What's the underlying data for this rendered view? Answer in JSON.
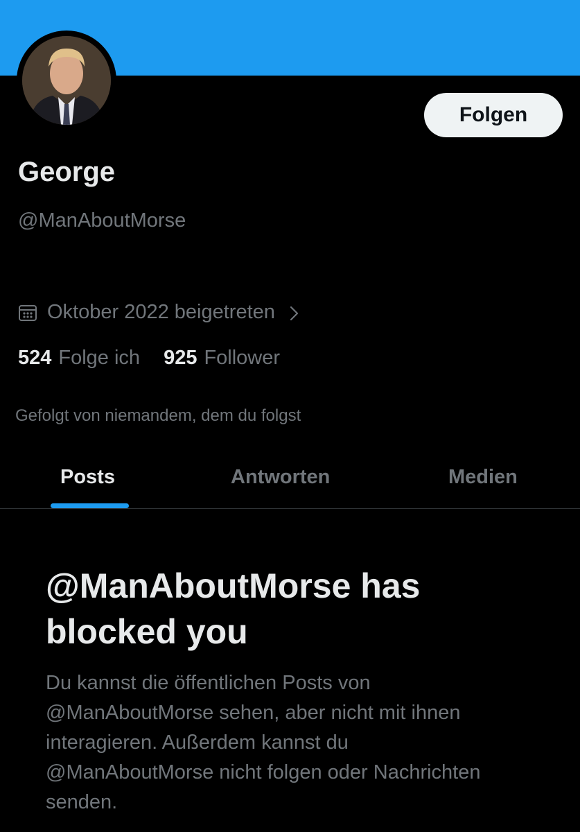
{
  "colors": {
    "accent": "#1d9bf0",
    "background": "#000000",
    "primary_text": "#e7e9ea",
    "secondary_text": "#71767b",
    "button_bg": "#eff3f4",
    "divider": "#2f3336"
  },
  "profile": {
    "display_name": "George",
    "handle": "@ManAboutMorse",
    "follow_label": "Folgen",
    "joined": "Oktober 2022 beigetreten",
    "joined_icon": "calendar-icon",
    "joined_chevron_icon": "chevron-right-icon",
    "avatar": "profile-photo"
  },
  "stats": {
    "following_count": "524",
    "following_label": "Folge ich",
    "followers_count": "925",
    "followers_label": "Follower"
  },
  "followed_by": "Gefolgt von niemandem, dem du folgst",
  "tabs": [
    {
      "label": "Posts",
      "active": true
    },
    {
      "label": "Antworten",
      "active": false
    },
    {
      "label": "Medien",
      "active": false
    }
  ],
  "blocked": {
    "title": "@ManAboutMorse has blocked you",
    "message": "Du kannst die öffentlichen Posts von @ManAboutMorse sehen, aber nicht mit ihnen interagieren. Außerdem kannst du @ManAboutMorse nicht folgen oder Nachrichten senden."
  }
}
